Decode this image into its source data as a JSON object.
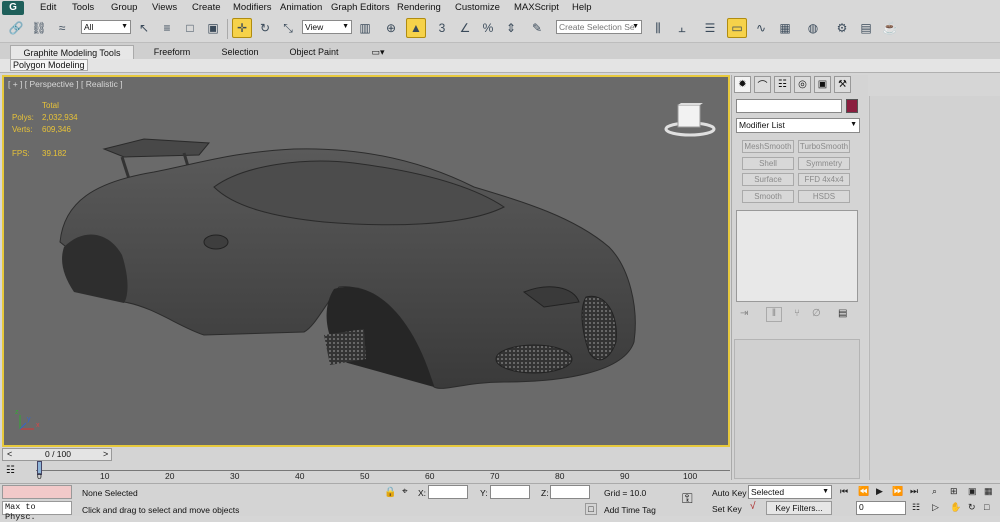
{
  "menu": [
    "Edit",
    "Tools",
    "Group",
    "Views",
    "Create",
    "Modifiers",
    "Animation",
    "Graph Editors",
    "Rendering",
    "Customize",
    "MAXScript",
    "Help"
  ],
  "toolbar": {
    "selection_filter": "All",
    "reference_coord": "View",
    "named_selection_placeholder": "Create Selection Se"
  },
  "ribbon": {
    "tabs": [
      "Graphite Modeling Tools",
      "Freeform",
      "Selection",
      "Object Paint"
    ],
    "panel_label": "Polygon Modeling"
  },
  "viewport": {
    "label": "[ + ] [ Perspective ] [ Realistic ]",
    "stats": {
      "total_header": "Total",
      "polys_label": "Polys:",
      "polys_value": "2,032,934",
      "verts_label": "Verts:",
      "verts_value": "609,346",
      "fps_label": "FPS:",
      "fps_value": "39.182"
    },
    "axis_x": "x",
    "axis_y": "y",
    "axis_z": "z"
  },
  "command_panel": {
    "tab_icons": [
      "create-icon",
      "modify-icon",
      "hierarchy-icon",
      "motion-icon",
      "display-icon",
      "utilities-icon"
    ],
    "modifier_list": "Modifier List",
    "modifier_buttons": [
      "MeshSmooth",
      "TurboSmooth",
      "Shell",
      "Symmetry",
      "Surface",
      "FFD 4x4x4",
      "Smooth",
      "HSDS"
    ],
    "swatch_color": "#8b1e3f"
  },
  "timeline": {
    "frame_display": "0 / 100",
    "prev": "<",
    "next": ">",
    "ticks": [
      "0",
      "10",
      "20",
      "30",
      "40",
      "50",
      "60",
      "70",
      "80",
      "90",
      "100"
    ]
  },
  "status": {
    "listener_label": "Max to Physc.",
    "selection_status": "None Selected",
    "prompt": "Click and drag to select and move objects",
    "x_label": "X:",
    "y_label": "Y:",
    "z_label": "Z:",
    "grid": "Grid = 10.0",
    "add_time_tag": "Add Time Tag",
    "auto_key": "Auto Key",
    "set_key": "Set Key",
    "key_mode": "Selected",
    "key_filters": "Key Filters...",
    "current_frame": "0"
  },
  "colors": {
    "viewport_bg": "#6a6a6a",
    "active_viewport_border": "#e7c93c",
    "stats_text": "#e8c338",
    "active_tool": "#f6d24a"
  }
}
